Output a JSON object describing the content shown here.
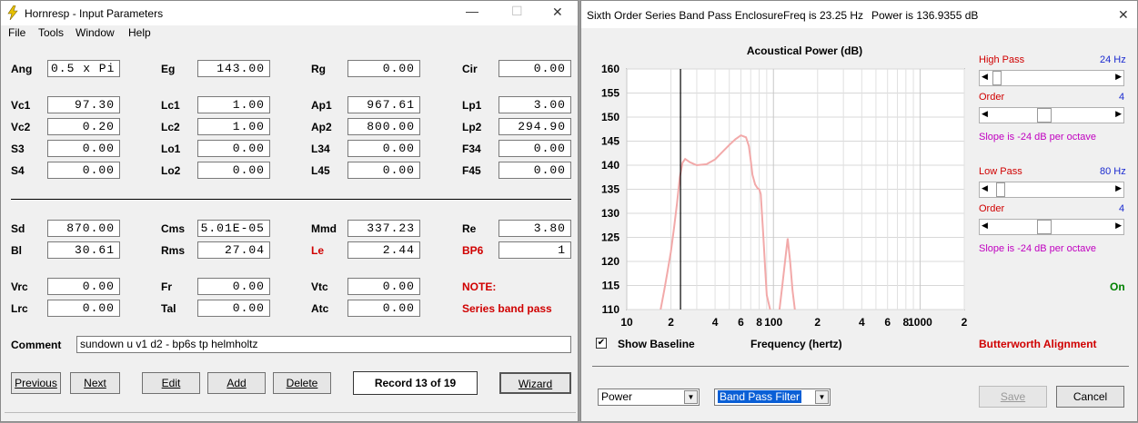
{
  "left_window": {
    "title": "Hornresp - Input Parameters",
    "menu": [
      "File",
      "Tools",
      "Window",
      "Help"
    ],
    "params": {
      "ang": {
        "label": "Ang",
        "value": "0.5 x Pi"
      },
      "eg": {
        "label": "Eg",
        "value": "143.00"
      },
      "rg": {
        "label": "Rg",
        "value": "0.00"
      },
      "cir": {
        "label": "Cir",
        "value": "0.00"
      },
      "vc1": {
        "label": "Vc1",
        "value": "97.30"
      },
      "lc1": {
        "label": "Lc1",
        "value": "1.00"
      },
      "ap1": {
        "label": "Ap1",
        "value": "967.61"
      },
      "lp1": {
        "label": "Lp1",
        "value": "3.00"
      },
      "vc2": {
        "label": "Vc2",
        "value": "0.20"
      },
      "lc2": {
        "label": "Lc2",
        "value": "1.00"
      },
      "ap2": {
        "label": "Ap2",
        "value": "800.00"
      },
      "lp2": {
        "label": "Lp2",
        "value": "294.90"
      },
      "s3": {
        "label": "S3",
        "value": "0.00"
      },
      "lo1": {
        "label": "Lo1",
        "value": "0.00"
      },
      "l34": {
        "label": "L34",
        "value": "0.00"
      },
      "f34": {
        "label": "F34",
        "value": "0.00"
      },
      "s4": {
        "label": "S4",
        "value": "0.00"
      },
      "lo2": {
        "label": "Lo2",
        "value": "0.00"
      },
      "l45": {
        "label": "L45",
        "value": "0.00"
      },
      "f45": {
        "label": "F45",
        "value": "0.00"
      },
      "sd": {
        "label": "Sd",
        "value": "870.00"
      },
      "cms": {
        "label": "Cms",
        "value": "5.01E-05"
      },
      "mmd": {
        "label": "Mmd",
        "value": "337.23"
      },
      "re": {
        "label": "Re",
        "value": "3.80"
      },
      "bl": {
        "label": "Bl",
        "value": "30.61"
      },
      "rms": {
        "label": "Rms",
        "value": "27.04"
      },
      "le": {
        "label": "Le",
        "value": "2.44"
      },
      "bp6": {
        "label": "BP6",
        "value": "1"
      },
      "vrc": {
        "label": "Vrc",
        "value": "0.00"
      },
      "fr": {
        "label": "Fr",
        "value": "0.00"
      },
      "vtc": {
        "label": "Vtc",
        "value": "0.00"
      },
      "lrc": {
        "label": "Lrc",
        "value": "0.00"
      },
      "tal": {
        "label": "Tal",
        "value": "0.00"
      },
      "atc": {
        "label": "Atc",
        "value": "0.00"
      }
    },
    "note_label": "NOTE:",
    "note_text": "Series band pass",
    "comment_label": "Comment",
    "comment_value": "sundown u v1 d2 - bp6s tp helmholtz",
    "buttons": {
      "previous": "Previous",
      "next": "Next",
      "edit": "Edit",
      "add": "Add",
      "delete": "Delete",
      "wizard": "Wizard"
    },
    "record": "Record 13 of 19"
  },
  "right_window": {
    "title": "Sixth Order Series Band Pass Enclosure",
    "freq": "Freq is 23.25 Hz",
    "power": "Power is 136.9355 dB",
    "high_pass": {
      "label": "High Pass",
      "value": "24 Hz",
      "order_label": "Order",
      "order_value": "4",
      "slope": "Slope is -24 dB per octave"
    },
    "low_pass": {
      "label": "Low Pass",
      "value": "80 Hz",
      "order_label": "Order",
      "order_value": "4",
      "slope": "Slope is -24 dB per octave"
    },
    "on_label": "On",
    "show_baseline": "Show Baseline",
    "alignment": "Butterworth Alignment",
    "select_left": "Power",
    "select_right": "Band Pass Filter",
    "save": "Save",
    "cancel": "Cancel"
  },
  "chart_data": {
    "type": "line",
    "title": "Acoustical Power (dB)",
    "xlabel": "Frequency (hertz)",
    "ylabel": "",
    "x_scale": "log",
    "xlim": [
      10,
      2000
    ],
    "ylim": [
      110,
      160
    ],
    "yticks": [
      "160",
      "155",
      "150",
      "145",
      "140",
      "135",
      "130",
      "125",
      "120",
      "115",
      "110"
    ],
    "xticks": [
      "10",
      "2",
      "4",
      "6",
      "8",
      "100",
      "2",
      "4",
      "6",
      "8",
      "1000",
      "2"
    ],
    "xtick_values": [
      10,
      20,
      40,
      60,
      80,
      100,
      200,
      400,
      600,
      800,
      1000,
      2000
    ],
    "marker_x": 23.25,
    "series": [
      {
        "x": [
          17,
          18,
          19,
          20,
          21,
          22,
          23,
          24,
          25,
          27,
          30,
          35,
          40,
          45,
          50,
          55,
          60,
          65,
          68,
          70,
          72,
          75,
          78,
          80,
          82,
          85,
          88,
          90,
          95,
          100,
          105,
          110,
          115,
          120,
          125,
          130,
          135,
          140,
          145,
          150,
          155,
          160
        ],
        "y": [
          110,
          114,
          118,
          122,
          127,
          132,
          137.5,
          140.5,
          141.3,
          140.6,
          140.0,
          140.2,
          141.2,
          142.8,
          144.2,
          145.4,
          146.2,
          145.8,
          144,
          141,
          138,
          136,
          135.2,
          135.0,
          134,
          126,
          118,
          113,
          110,
          108,
          107,
          110,
          115,
          120,
          124.8,
          120,
          114,
          110,
          108,
          106,
          104,
          102
        ]
      }
    ],
    "color": "#f2a9a9"
  }
}
